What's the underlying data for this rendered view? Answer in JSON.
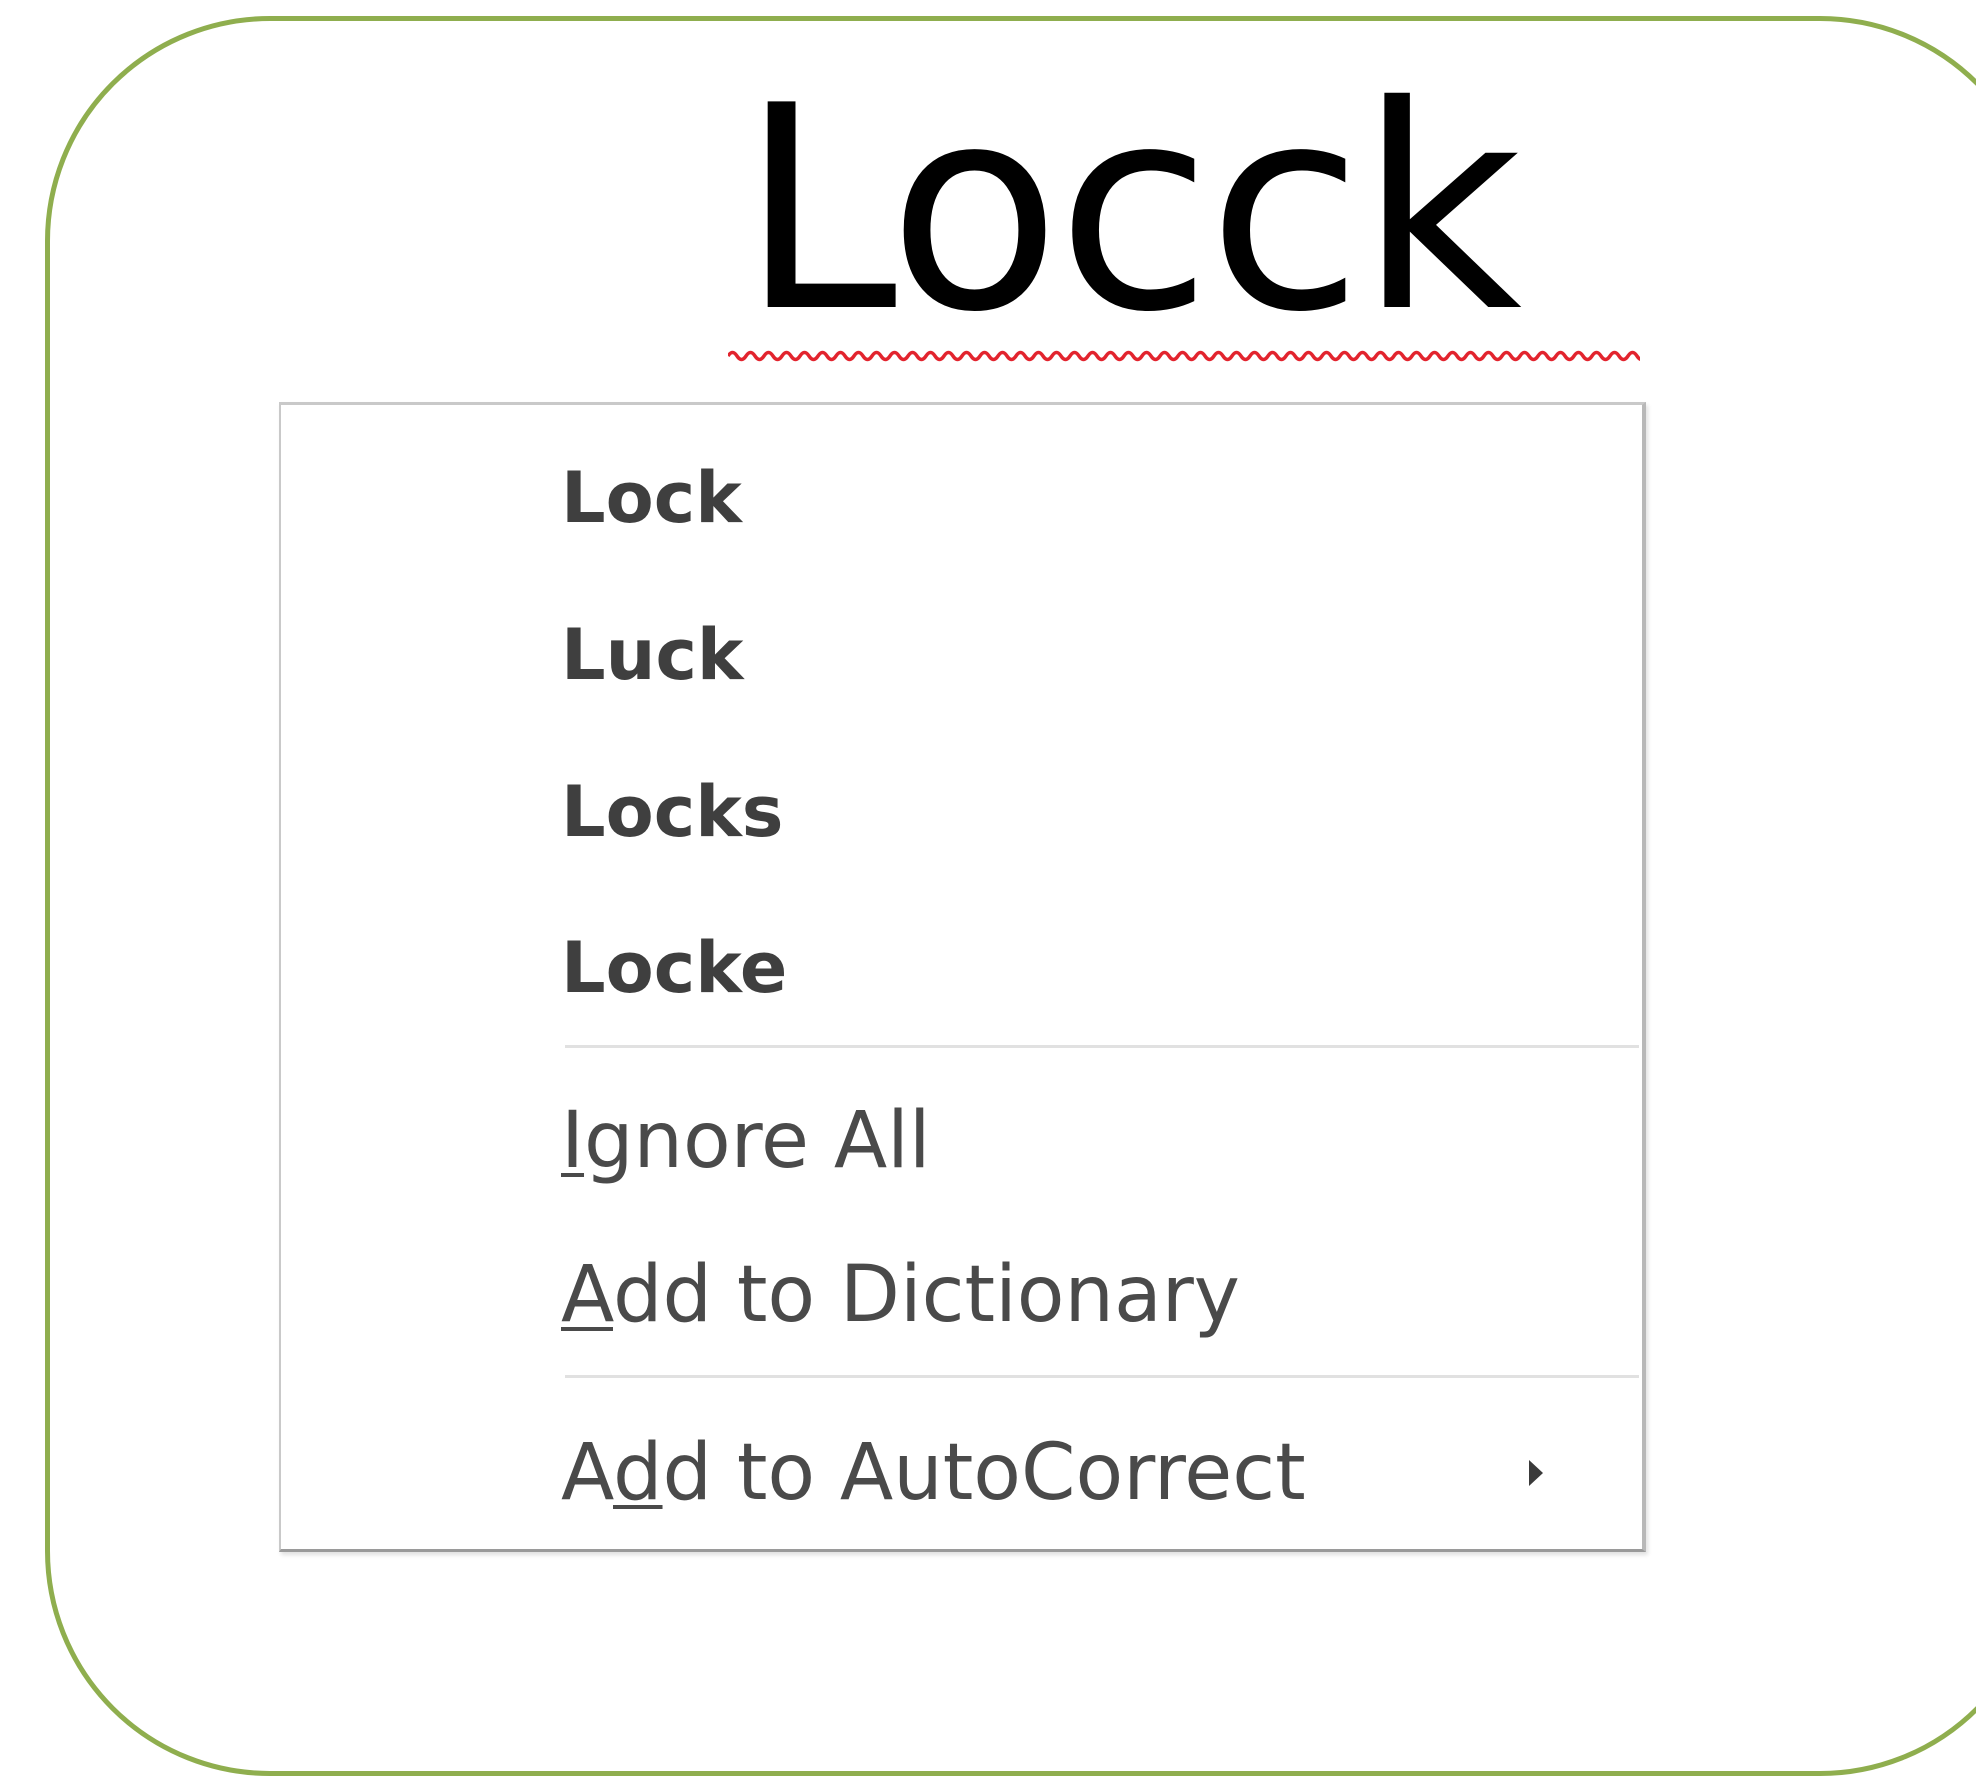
{
  "misspelled_word": "Locck",
  "colors": {
    "frame_border": "#8fae4e",
    "squiggle": "#e2242e",
    "menu_text": "#444444"
  },
  "context_menu": {
    "suggestions": [
      "Lock",
      "Luck",
      "Locks",
      "Locke"
    ],
    "ignore_all": {
      "mnemonic": "I",
      "rest": "gnore All"
    },
    "add_to_dictionary": {
      "mnemonic": "A",
      "rest": "dd to Dictionary"
    },
    "add_to_autocorrect": {
      "pre": "A",
      "mnemonic": "d",
      "rest": "d to AutoCorrect"
    },
    "submenu_icon": "chevron-right-icon"
  }
}
